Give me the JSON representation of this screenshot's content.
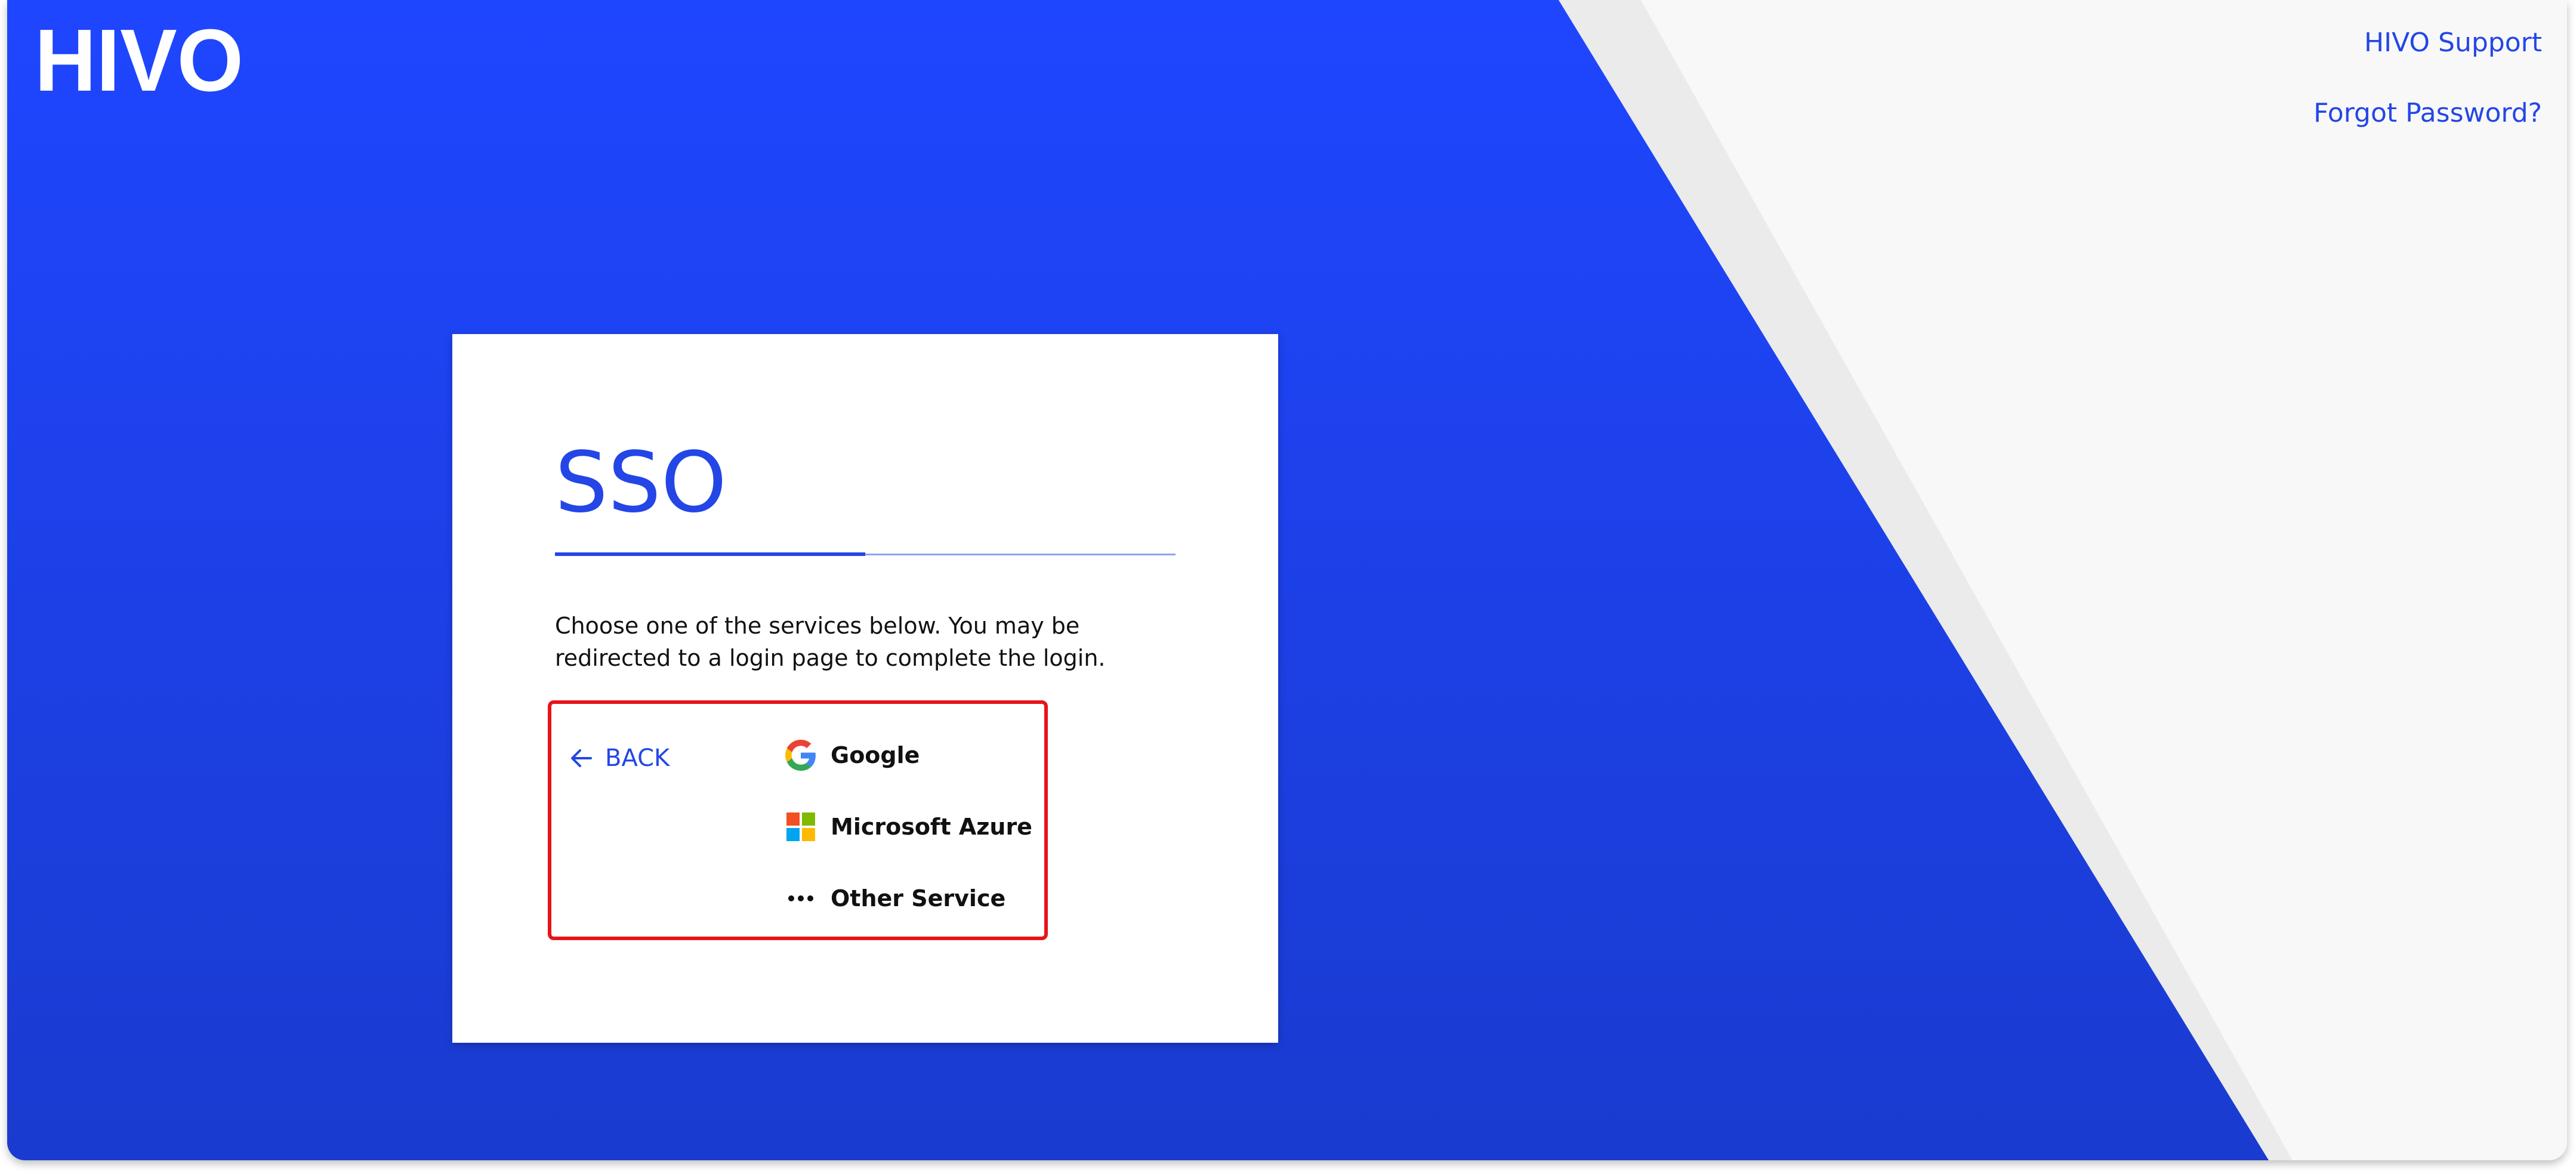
{
  "header": {
    "logo_text": "HIVO",
    "support_link": "HIVO Support",
    "forgot_link": "Forgot Password?"
  },
  "colors": {
    "brand_blue": "#2446e6",
    "highlight_red": "#e8141b",
    "panel_grey": "#f8f8f8"
  },
  "card": {
    "title": "SSO",
    "description": "Choose one of the services below. You may be redirected to a login page to complete the login.",
    "back_label": "BACK",
    "services": [
      {
        "label": "Google",
        "icon": "google-icon"
      },
      {
        "label": "Microsoft Azure",
        "icon": "microsoft-icon"
      },
      {
        "label": "Other Service",
        "icon": "more-dots-icon"
      }
    ]
  }
}
